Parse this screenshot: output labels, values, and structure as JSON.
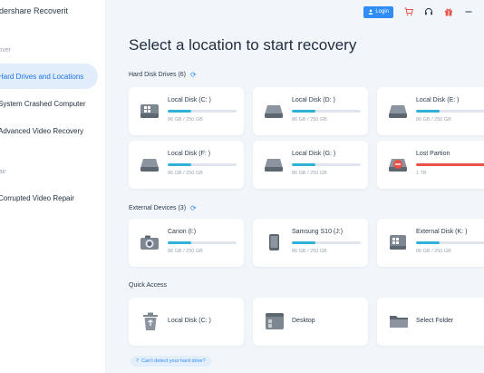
{
  "app": {
    "title": "ndershare Recoverit"
  },
  "sidebar": {
    "sections": [
      {
        "label": "ecover"
      },
      {
        "label": "epair"
      }
    ],
    "items": [
      {
        "label": "Hard Drives and Locations",
        "active": true
      },
      {
        "label": "System Crashed Computer"
      },
      {
        "label": "Advanced Video Recovery"
      },
      {
        "label": "Corrupted Video Repair"
      }
    ]
  },
  "topbar": {
    "login_label": "Login",
    "icons": [
      "cart-icon",
      "headset-icon",
      "gift-icon",
      "minimize-icon"
    ]
  },
  "main": {
    "title": "Select a location to start recovery",
    "hard_disk": {
      "title": "Hard Disk Drives (6)",
      "drives": [
        {
          "name": "Local Disk (C: )",
          "size": "86 GB / 250 GB",
          "used": 0.34
        },
        {
          "name": "Local Disk (D: )",
          "size": "86 GB / 250 GB",
          "used": 0.34
        },
        {
          "name": "Local Disk (E: )",
          "size": "86 GB / 250 GB",
          "used": 0.34
        },
        {
          "name": "Local Disk (F: )",
          "size": "86 GB / 250 GB",
          "used": 0.34
        },
        {
          "name": "Local Disk (G: )",
          "size": "86 GB / 250 GB",
          "used": 0.34
        },
        {
          "name": "Lost Partion",
          "size": "1 TB",
          "used": 1.0
        }
      ]
    },
    "external": {
      "title": "External Devices (3)",
      "devices": [
        {
          "name": "Canon (I:)",
          "size": "86 GB / 250 GB",
          "used": 0.34
        },
        {
          "name": "Samsung S10  (J:)",
          "size": "86 GB / 250 GB",
          "used": 0.34
        },
        {
          "name": "External Disk (K: )",
          "size": "86 GB / 250 GB",
          "used": 0.34
        }
      ]
    },
    "quick_access": {
      "title": "Quick Access",
      "items": [
        {
          "name": "Local Disk (C: )"
        },
        {
          "name": "Desktop"
        },
        {
          "name": "Select Folder"
        }
      ]
    },
    "help_link": "Can't detect your hard drive?"
  },
  "colors": {
    "accent": "#2f8df5",
    "bar_fill": "#2fb1d8",
    "lost_partition": "#e8524a"
  }
}
